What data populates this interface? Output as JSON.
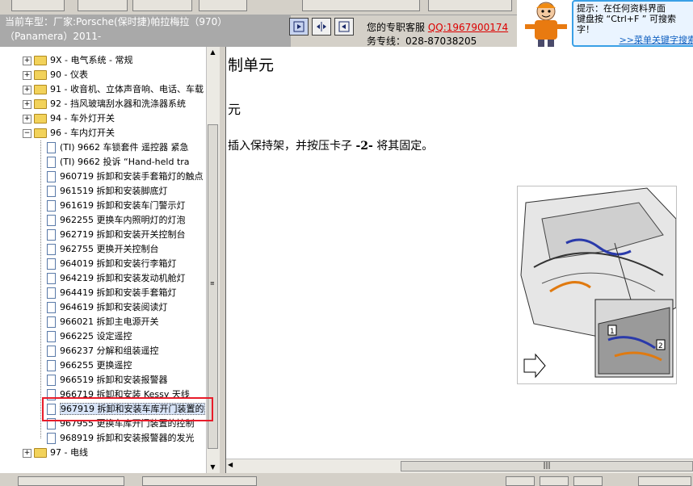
{
  "header": {
    "car_line1": "当前车型：厂家:Porsche(保时捷)帕拉梅拉（970）",
    "car_line2": "（Panamera）2011-",
    "contact_label": "您的专职客服",
    "qq": "QQ:1967900174",
    "phone": "务专线：028-87038205"
  },
  "tip": {
    "line1": "提示：在任何资料界面",
    "line2": "键盘按 “Ctrl+F ” 可搜索",
    "line3": "字！",
    "link": ">>菜单关键字搜索"
  },
  "tree": {
    "items": [
      {
        "type": "folder",
        "expanded": false,
        "label": "9X - 电气系统 - 常规"
      },
      {
        "type": "folder",
        "expanded": false,
        "label": "90 - 仪表"
      },
      {
        "type": "folder",
        "expanded": false,
        "label": "91 - 收音机、立体声音响、电话、车载"
      },
      {
        "type": "folder",
        "expanded": false,
        "label": "92 - 挡风玻璃刮水器和洗涤器系统"
      },
      {
        "type": "folder",
        "expanded": false,
        "label": "94 - 车外灯开关"
      },
      {
        "type": "folder",
        "expanded": true,
        "label": "96 - 车内灯开关"
      },
      {
        "type": "doc",
        "label": "(TI) 9662 车锁套件 遥控器 紧急"
      },
      {
        "type": "doc",
        "label": "(TI) 9662 投诉 “Hand-held tra"
      },
      {
        "type": "doc",
        "label": "960719 拆卸和安装手套箱灯的触点"
      },
      {
        "type": "doc",
        "label": "961519 拆卸和安装脚底灯"
      },
      {
        "type": "doc",
        "label": "961619 拆卸和安装车门警示灯"
      },
      {
        "type": "doc",
        "label": "962255 更换车内照明灯的灯泡"
      },
      {
        "type": "doc",
        "label": "962719 拆卸和安装开关控制台"
      },
      {
        "type": "doc",
        "label": "962755 更换开关控制台"
      },
      {
        "type": "doc",
        "label": "964019 拆卸和安装行李箱灯"
      },
      {
        "type": "doc",
        "label": "964219 拆卸和安装发动机舱灯"
      },
      {
        "type": "doc",
        "label": "964419 拆卸和安装手套箱灯"
      },
      {
        "type": "doc",
        "label": "964619 拆卸和安装阅读灯"
      },
      {
        "type": "doc",
        "label": "966021 拆卸主电源开关"
      },
      {
        "type": "doc",
        "label": "966225 设定遥控"
      },
      {
        "type": "doc",
        "label": "966237 分解和组装遥控"
      },
      {
        "type": "doc",
        "label": "966255 更换遥控"
      },
      {
        "type": "doc",
        "label": "966519 拆卸和安装报警器"
      },
      {
        "type": "doc",
        "label": "966719 拆卸和安装 Kessy 天线"
      },
      {
        "type": "doc",
        "label": "967919 拆卸和安装车库开门装置的"
      },
      {
        "type": "doc",
        "label": "967955 更换车库开门装置的控制"
      },
      {
        "type": "doc",
        "label": "968919 拆卸和安装报警器的发光"
      },
      {
        "type": "folder",
        "expanded": false,
        "label": "97 - 电线"
      }
    ]
  },
  "content": {
    "title": "制单元",
    "subtitle": "元",
    "paragraph_pre": "插入保持架，并按压卡子 ",
    "paragraph_bold": "-2-",
    "paragraph_post": " 将其固定。",
    "figure_label_1": "1",
    "figure_label_2": "2"
  },
  "scroll": {
    "thumb_grip": "|||"
  }
}
